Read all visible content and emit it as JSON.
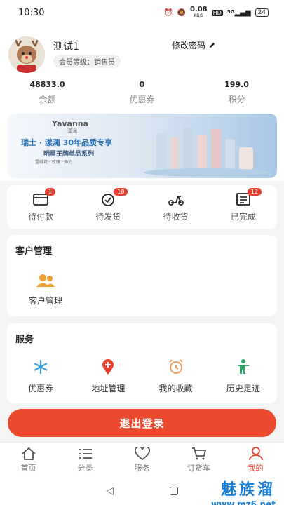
{
  "status_bar": {
    "time": "10:30",
    "net_speed": "0.08",
    "net_unit": "KB/S",
    "hd": "HD",
    "signal": "5G",
    "battery": "24"
  },
  "profile": {
    "username": "测试1",
    "member_level": "会员等级：销售员",
    "change_password": "修改密码"
  },
  "stats": [
    {
      "value": "48833.0",
      "label": "余额"
    },
    {
      "value": "0",
      "label": "优惠券"
    },
    {
      "value": "199.0",
      "label": "积分"
    }
  ],
  "banner": {
    "brand": "Yavanna",
    "brand_cn": "漾澜",
    "title": "瑞士 · 漾澜 30年品质专享",
    "subtitle": "明星王牌单品系列",
    "small": "雪绒花 · 玫瑰 · 神力"
  },
  "orders": [
    {
      "label": "待付款",
      "badge": "1",
      "icon": "wallet-icon"
    },
    {
      "label": "待发货",
      "badge": "18",
      "icon": "box-icon"
    },
    {
      "label": "待收货",
      "badge": "",
      "icon": "scooter-icon"
    },
    {
      "label": "已完成",
      "badge": "12",
      "icon": "receipt-icon"
    }
  ],
  "customer": {
    "title": "客户管理",
    "item_label": "客户管理"
  },
  "services": {
    "title": "服务",
    "items": [
      {
        "label": "优惠券",
        "icon": "snowflake-icon"
      },
      {
        "label": "地址管理",
        "icon": "location-pin-icon"
      },
      {
        "label": "我的收藏",
        "icon": "alarm-clock-icon"
      },
      {
        "label": "历史足迹",
        "icon": "person-icon"
      }
    ]
  },
  "logout_label": "退出登录",
  "tabs": [
    {
      "label": "首页",
      "icon": "home-icon"
    },
    {
      "label": "分类",
      "icon": "list-icon"
    },
    {
      "label": "服务",
      "icon": "heart-icon"
    },
    {
      "label": "订货车",
      "icon": "cart-icon"
    },
    {
      "label": "我的",
      "icon": "user-icon"
    }
  ],
  "watermark": {
    "text": "魅族溜",
    "url": "www.mz6.net"
  },
  "colors": {
    "accent": "#e8402e",
    "logout_bg": "#eb4a2e",
    "snowflake": "#3aa0d8",
    "pin": "#e8402e",
    "clock": "#f0a060",
    "person": "#2fa46a",
    "group": "#f0a030"
  }
}
